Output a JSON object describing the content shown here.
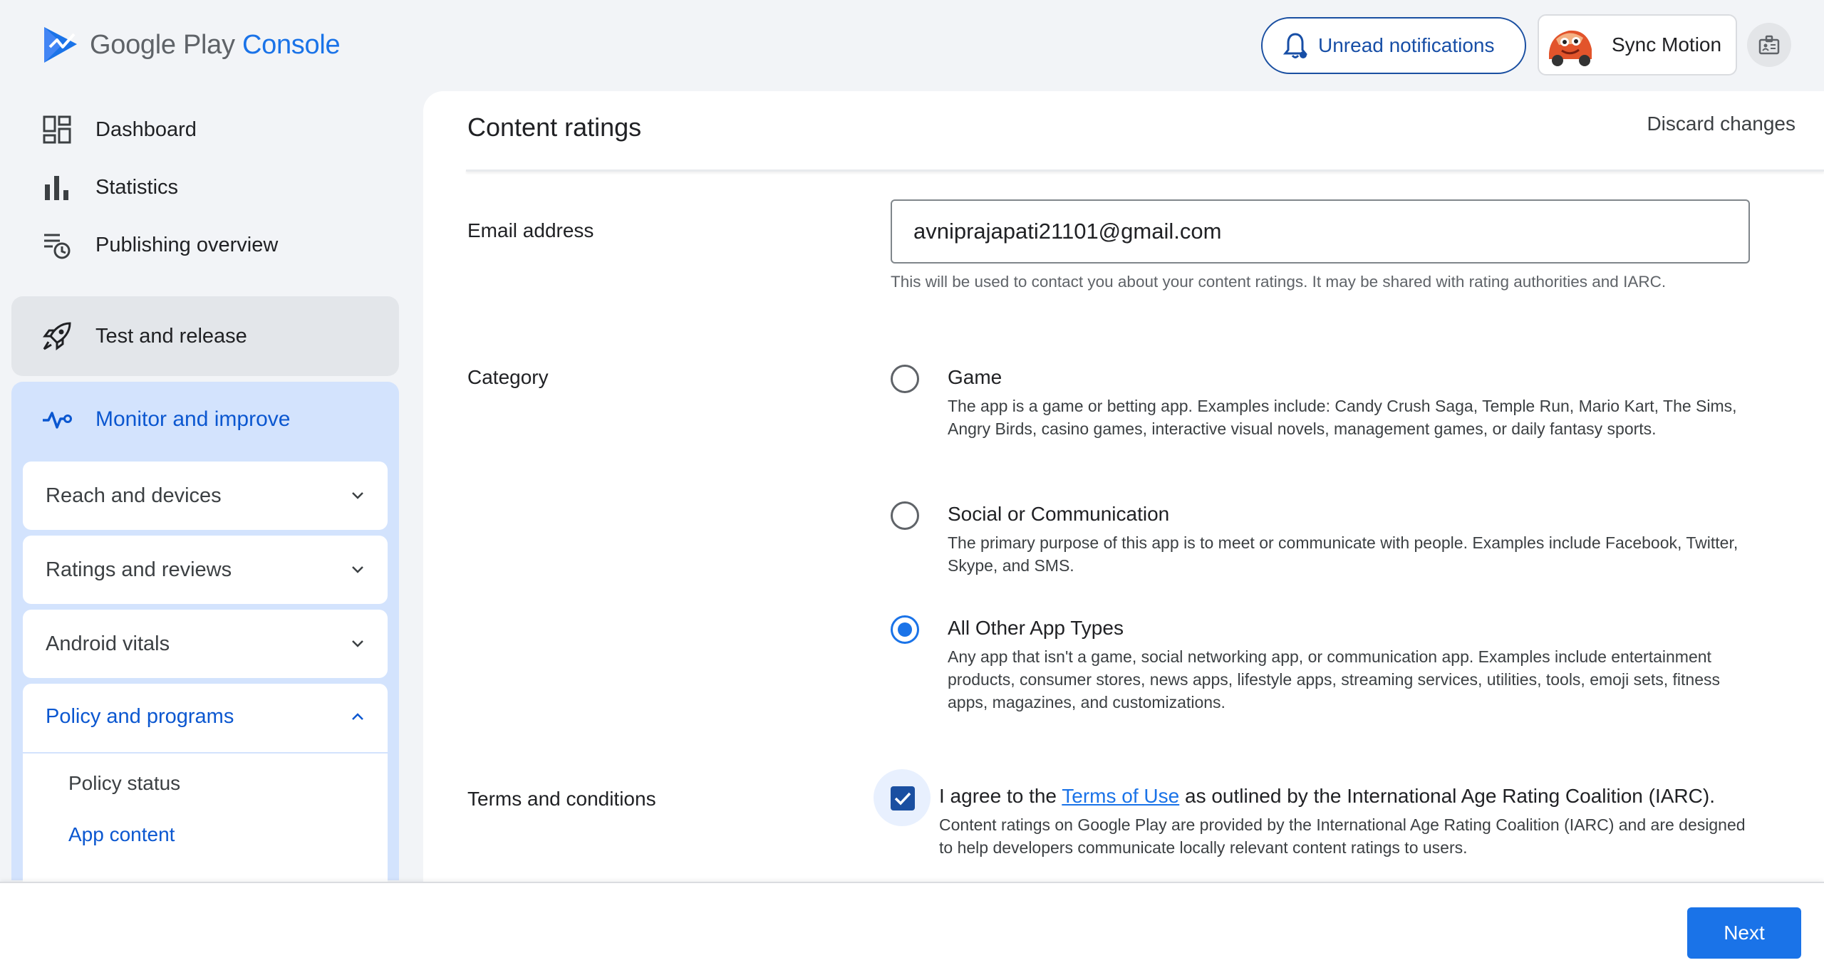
{
  "brand": {
    "google_play": "Google Play",
    "console": "Console"
  },
  "header": {
    "notifications_label": "Unread notifications",
    "account_name": "Sync Motion"
  },
  "sidebar": {
    "items": [
      {
        "label": "Dashboard",
        "icon": "dashboard-icon"
      },
      {
        "label": "Statistics",
        "icon": "bar-chart-icon"
      },
      {
        "label": "Publishing overview",
        "icon": "publishing-overview-icon"
      }
    ],
    "test_release": "Test and release",
    "monitor_improve": "Monitor and improve",
    "groups": [
      {
        "label": "Reach and devices"
      },
      {
        "label": "Ratings and reviews"
      },
      {
        "label": "Android vitals"
      },
      {
        "label": "Policy and programs"
      }
    ],
    "policy_children": [
      "Policy status",
      "App content"
    ]
  },
  "main": {
    "title": "Content ratings",
    "discard_label": "Discard changes",
    "email": {
      "label": "Email address",
      "value": "avniprajapati21101@gmail.com",
      "helper": "This will be used to contact you about your content ratings. It may be shared with rating authorities and IARC."
    },
    "category": {
      "label": "Category",
      "options": [
        {
          "title": "Game",
          "desc": "The app is a game or betting app. Examples include: Candy Crush Saga, Temple Run, Mario Kart, The Sims, Angry Birds, casino games, interactive visual novels, management games, or daily fantasy sports.",
          "selected": false
        },
        {
          "title": "Social or Communication",
          "desc": "The primary purpose of this app is to meet or communicate with people. Examples include Facebook, Twitter, Skype, and SMS.",
          "selected": false
        },
        {
          "title": "All Other App Types",
          "desc": "Any app that isn't a game, social networking app, or communication app. Examples include entertainment products, consumer stores, news apps, lifestyle apps, streaming services, utilities, tools, emoji sets, fitness apps, magazines, and customizations.",
          "selected": true
        }
      ]
    },
    "terms": {
      "label": "Terms and conditions",
      "agree_prefix": "I agree to the ",
      "agree_link": "Terms of Use",
      "agree_suffix": " as outlined by the International Age Rating Coalition (IARC).",
      "desc": "Content ratings on Google Play are provided by the International Age Rating Coalition (IARC) and are designed to help developers communicate locally relevant content ratings to users.",
      "checked": true
    }
  },
  "footer": {
    "next_label": "Next"
  },
  "colors": {
    "accent": "#1a73e8",
    "nav_active_bg": "#d3e3fd",
    "nav_active_text": "#0b57d0"
  }
}
